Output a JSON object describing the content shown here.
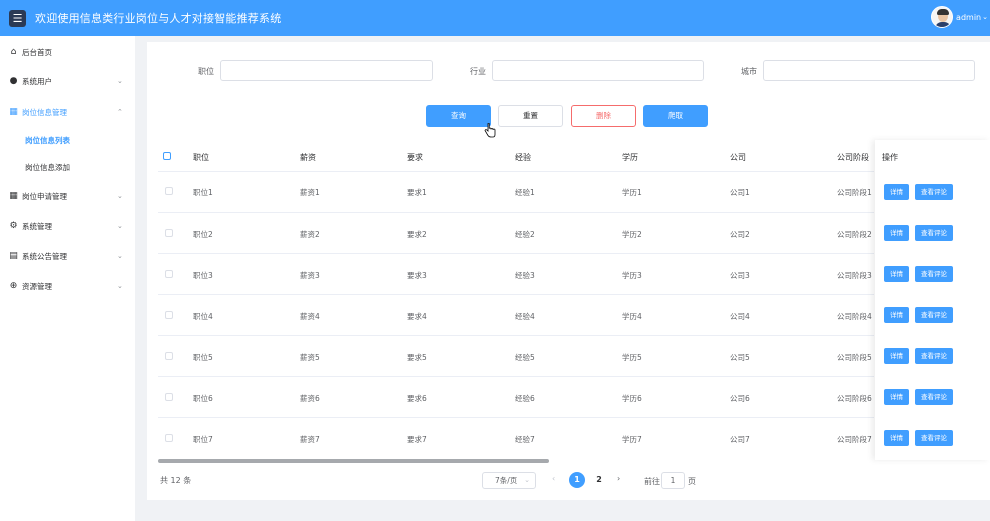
{
  "header": {
    "title": "欢迎使用信息类行业岗位与人才对接智能推荐系统",
    "username": "admin"
  },
  "sidebar": {
    "items": [
      {
        "label": "后台首页"
      },
      {
        "label": "系统用户"
      },
      {
        "label": "岗位信息管理"
      },
      {
        "label": "岗位申请管理"
      },
      {
        "label": "系统管理"
      },
      {
        "label": "系统公告管理"
      },
      {
        "label": "资源管理"
      }
    ],
    "sub_items": [
      {
        "label": "岗位信息列表"
      },
      {
        "label": "岗位信息添加"
      }
    ]
  },
  "filters": {
    "position_label": "职位",
    "position_value": "",
    "industry_label": "行业",
    "industry_value": "",
    "city_label": "城市",
    "city_value": ""
  },
  "actions": {
    "query": "查询",
    "reset": "重置",
    "delete": "删除",
    "crawl": "爬取"
  },
  "table": {
    "columns": [
      "职位",
      "薪资",
      "要求",
      "经验",
      "学历",
      "公司",
      "公司阶段"
    ],
    "ops_header": "操作",
    "rows": [
      [
        "职位1",
        "薪资1",
        "要求1",
        "经验1",
        "学历1",
        "公司1",
        "公司阶段1"
      ],
      [
        "职位2",
        "薪资2",
        "要求2",
        "经验2",
        "学历2",
        "公司2",
        "公司阶段2"
      ],
      [
        "职位3",
        "薪资3",
        "要求3",
        "经验3",
        "学历3",
        "公司3",
        "公司阶段3"
      ],
      [
        "职位4",
        "薪资4",
        "要求4",
        "经验4",
        "学历4",
        "公司4",
        "公司阶段4"
      ],
      [
        "职位5",
        "薪资5",
        "要求5",
        "经验5",
        "学历5",
        "公司5",
        "公司阶段5"
      ],
      [
        "职位6",
        "薪资6",
        "要求6",
        "经验6",
        "学历6",
        "公司6",
        "公司阶段6"
      ],
      [
        "职位7",
        "薪资7",
        "要求7",
        "经验7",
        "学历7",
        "公司7",
        "公司阶段7"
      ]
    ],
    "row_actions": {
      "detail": "详情",
      "comments": "查看评论"
    }
  },
  "pagination": {
    "total": "共 12 条",
    "page_size": "7条/页",
    "pages": [
      "1",
      "2"
    ],
    "current": "1",
    "goto_prefix": "前往",
    "goto_value": "1",
    "goto_suffix": "页"
  },
  "colors": {
    "primary": "#409eff",
    "danger": "#f56c6c",
    "background": "#f0f2f5"
  }
}
